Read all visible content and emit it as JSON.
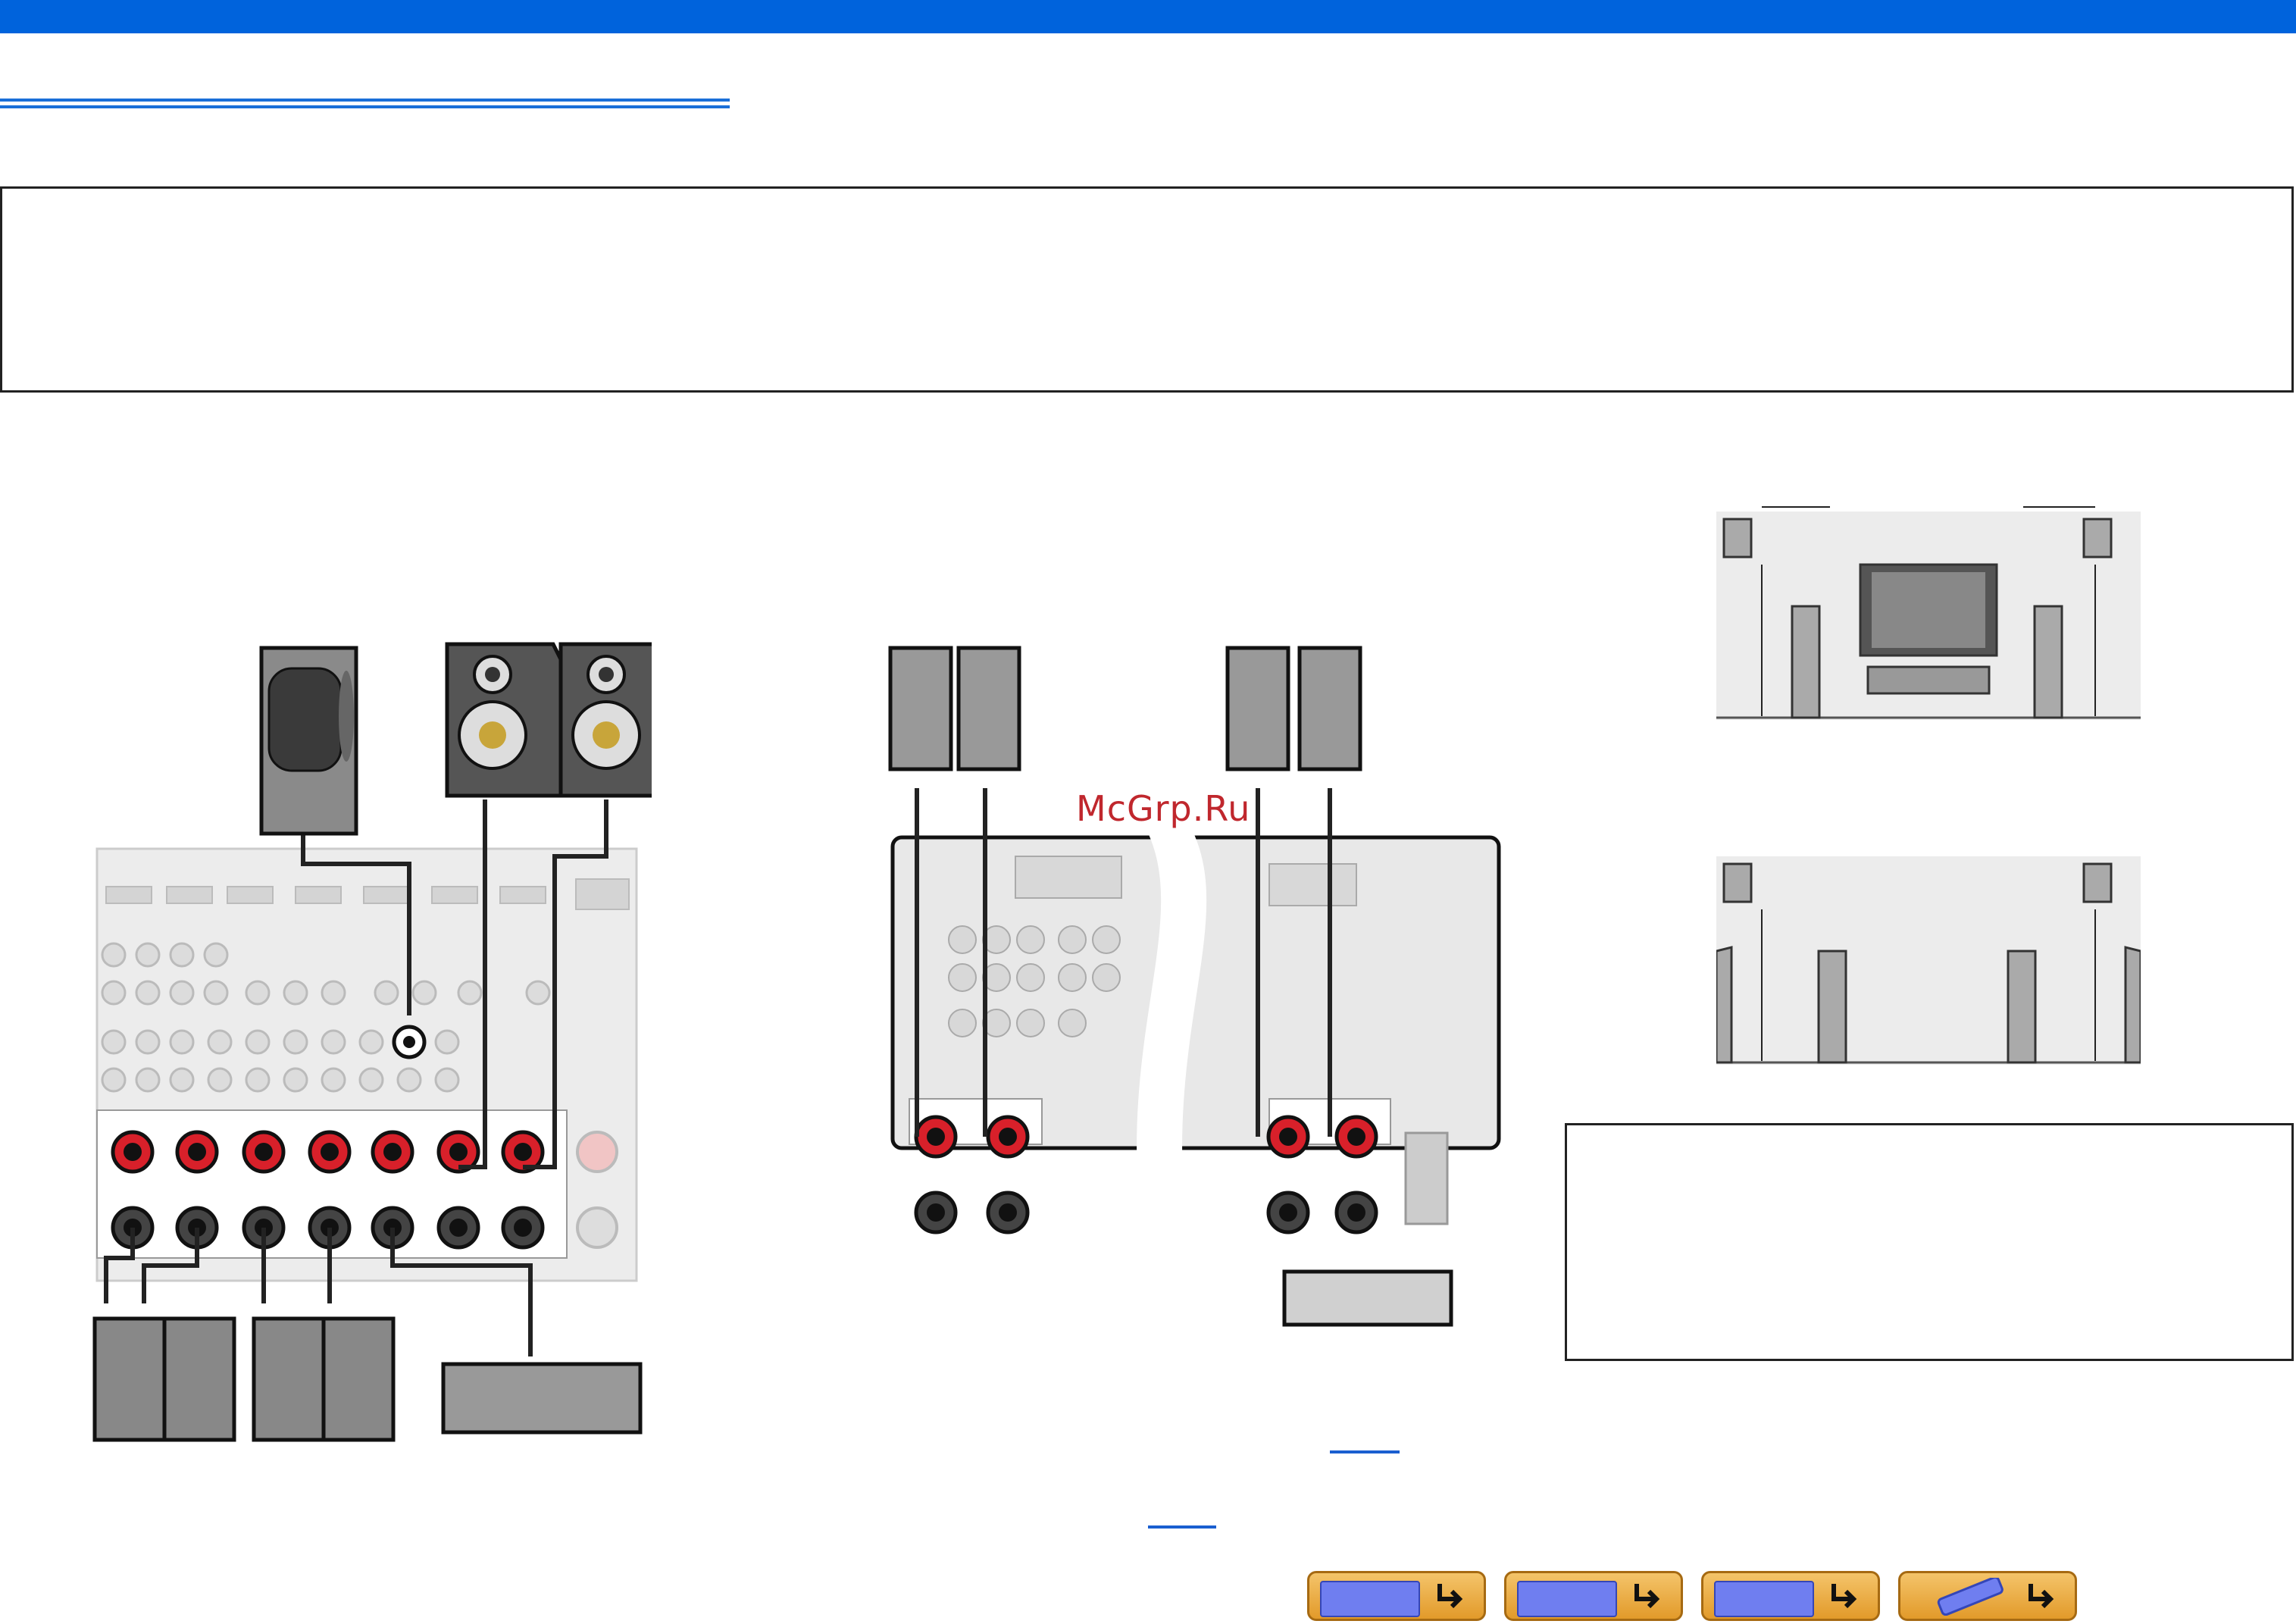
{
  "header": {
    "bar_color": "#0063dc",
    "underline_color": "#1a6fd8"
  },
  "watermark": {
    "text": "McGrp.Ru"
  },
  "links": [
    {
      "text": ""
    },
    {
      "text": ""
    }
  ],
  "nav_buttons": [
    {
      "icon": "receiver-front-icon"
    },
    {
      "icon": "receiver-rear-icon"
    },
    {
      "icon": "menu-list-icon"
    },
    {
      "icon": "remote-control-icon"
    }
  ],
  "colors": {
    "red_terminal": "#d8202a",
    "wire": "#222222",
    "panel": "#e6e6e6"
  }
}
